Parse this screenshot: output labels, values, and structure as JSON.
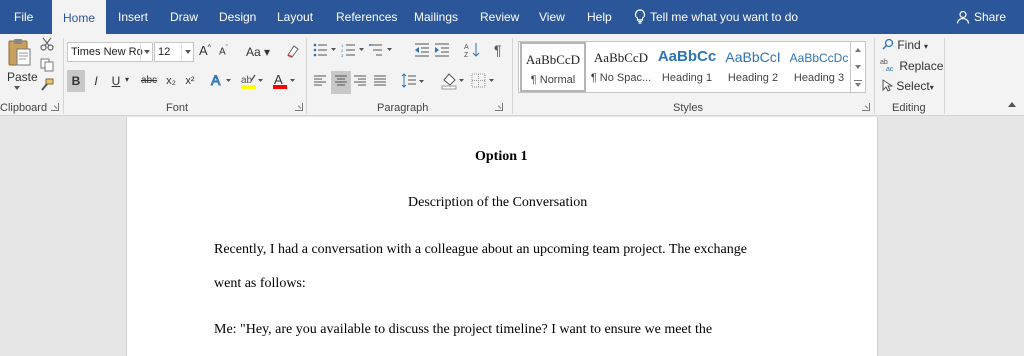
{
  "tabs": {
    "file": "File",
    "home": "Home",
    "insert": "Insert",
    "draw": "Draw",
    "design": "Design",
    "layout": "Layout",
    "references": "References",
    "mailings": "Mailings",
    "review": "Review",
    "view": "View",
    "help": "Help",
    "tell_me": "Tell me what you want to do",
    "share": "Share"
  },
  "clipboard": {
    "paste_label": "Paste",
    "group_label": "Clipboard"
  },
  "font": {
    "font_name": "Times New Ro",
    "font_size": "12",
    "change_case": "Aa",
    "bold": "B",
    "italic": "I",
    "underline": "U",
    "strikethrough": "abc",
    "subscript": "x₂",
    "superscript": "x²",
    "group_label": "Font"
  },
  "paragraph": {
    "group_label": "Paragraph"
  },
  "styles": {
    "items": [
      {
        "sample": "AaBbCcD",
        "name": "¶ Normal"
      },
      {
        "sample": "AaBbCcD",
        "name": "¶ No Spac..."
      },
      {
        "sample": "AaBbCc",
        "name": "Heading 1"
      },
      {
        "sample": "AaBbCcI",
        "name": "Heading 2"
      },
      {
        "sample": "AaBbCcDc",
        "name": "Heading 3"
      }
    ],
    "group_label": "Styles"
  },
  "editing": {
    "find": "Find",
    "replace": "Replace",
    "select": "Select",
    "group_label": "Editing"
  },
  "document": {
    "title": "Option 1",
    "subtitle": "Description of the Conversation",
    "para1_line1": "Recently, I had a conversation with a colleague about an upcoming team project. The exchange",
    "para1_line2": "went as follows:",
    "para2_line1": "Me: \"Hey, are you available to discuss the project timeline? I want to ensure we meet the"
  },
  "colors": {
    "title_bar": "#2b579a",
    "ribbon_bg": "#f3f3f3",
    "doc_bg": "#e6e6e6",
    "page_bg": "#ffffff",
    "highlight_yellow": "#ffff00",
    "font_color_red": "#ff0000",
    "heading_blue": "#2e74b5"
  }
}
